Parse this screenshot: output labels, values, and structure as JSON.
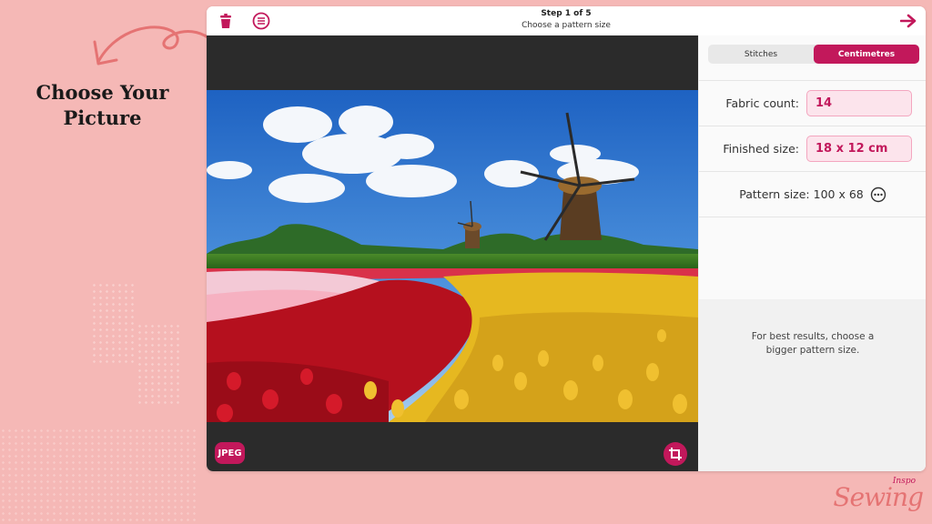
{
  "slide": {
    "heading_line1": "Choose Your",
    "heading_line2": "Picture",
    "brand_small": "Inspo",
    "brand_big": "Sewing"
  },
  "app": {
    "step_title": "Step 1 of 5",
    "step_subtitle": "Choose a pattern size",
    "icons": {
      "delete": "trash-icon",
      "menu": "menu-icon",
      "next": "arrow-right-icon",
      "crop": "crop-icon",
      "more": "more-icon"
    },
    "format_badge": "JPEG",
    "unit_tabs": [
      {
        "label": "Stitches",
        "active": false
      },
      {
        "label": "Centimetres",
        "active": true
      }
    ],
    "fabric_count": {
      "label": "Fabric count:",
      "value": "14"
    },
    "finished_size": {
      "label": "Finished size:",
      "value": "18 x 12 cm"
    },
    "pattern_size": {
      "label": "Pattern size: 100 x 68"
    },
    "hint": "For best results, choose a bigger pattern size."
  },
  "colors": {
    "accent": "#c2185b",
    "background": "#f5b8b6",
    "field_bg": "#fce4ec"
  }
}
